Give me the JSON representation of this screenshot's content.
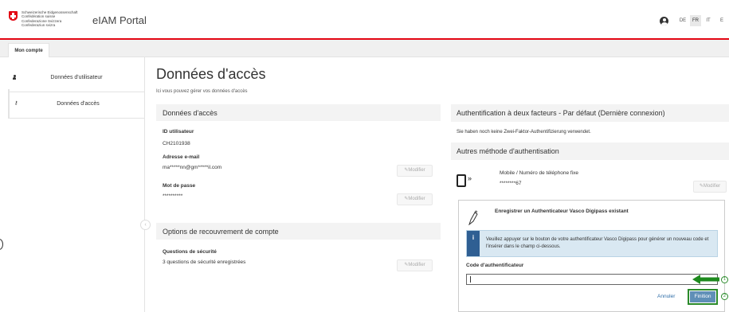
{
  "header": {
    "confederation_lines": [
      "Schweizerische Eidgenossenschaft",
      "Confédération suisse",
      "Confederazione Svizzera",
      "Confederaziun svizra"
    ],
    "app_title": "eIAM Portal",
    "languages": [
      "DE",
      "FR",
      "IT",
      "E"
    ],
    "active_language": "FR",
    "accent_color": "#e30613"
  },
  "tabs": {
    "mon_compte": "Mon compte"
  },
  "sidebar": {
    "items": [
      {
        "label": "Données d'utilisateur",
        "icon": "person-icon"
      },
      {
        "label": "Données d'accès",
        "icon": "key-icon"
      }
    ]
  },
  "main": {
    "title": "Données d'accès",
    "subtitle": "Ici vous pouvez gérer vos données d'accès",
    "acces_panel": {
      "heading": "Données d'accès",
      "user_id_label": "ID utilisateur",
      "user_id_value": "CH2101938",
      "email_label": "Adresse e-mail",
      "email_value": "ma*****nn@gm*****il.com",
      "password_label": "Mot de passe",
      "password_value": "**********",
      "modify_label": "✎Modifier"
    },
    "recovery_panel": {
      "heading": "Options de recouvrement de compte",
      "questions_label": "Questions de sécurité",
      "questions_value": "3 questions de sécurité enregistrées",
      "modify_label": "✎Modifier"
    },
    "twofa_panel": {
      "heading": "Authentification à deux facteurs - Par défaut (Dernière connexion)",
      "note": "Sie haben noch keine Zwei-Faktor-Authentifizierung verwendet.",
      "other_methods_heading": "Autres méthode d'authentisation",
      "mobile_label": "Mobile / Numéro de téléphone fixe",
      "mobile_value": "********67",
      "modify_label": "✎Modifier",
      "enroll": {
        "title": "Enregistrer un Authenticateur Vasco Digipass existant",
        "info_icon": "i",
        "info_text": "Veuillez appuyer sur le bouton de votre authentificateur Vasco Digipass pour générer un nouveau code et l'insérer dans le champ ci-dessous.",
        "code_label": "Code d'authentificateur",
        "code_value": "",
        "cancel_label": "Annuler",
        "submit_label": "Finition"
      }
    }
  },
  "annotations": {
    "marker_1": "1",
    "marker_2": "2",
    "color": "#2a8a2a"
  }
}
